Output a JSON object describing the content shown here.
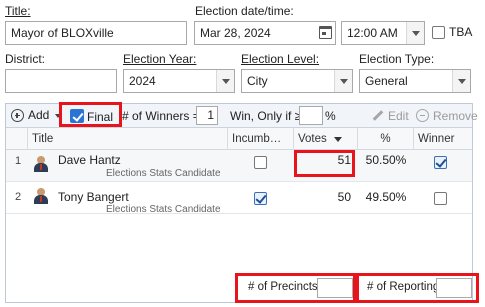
{
  "form": {
    "title_label": "Title:",
    "title_value": "Mayor of BLOXville",
    "date_label": "Election date/time:",
    "date_value": "Mar 28, 2024",
    "time_value": "12:00 AM",
    "tba_label": "TBA",
    "district_label": "District:",
    "district_value": "",
    "year_label": "Election Year:",
    "year_value": "2024",
    "level_label": "Election Level:",
    "level_value": "City",
    "type_label": "Election Type:",
    "type_value": "General"
  },
  "toolbar": {
    "add_label": "Add",
    "final_label": "Final",
    "winners_label": "# of Winners =",
    "winners_value": "1",
    "win_only_label": "Win, Only if ≥",
    "win_only_value": "",
    "percent_sign": "%",
    "edit_label": "Edit",
    "remove_label": "Remove"
  },
  "columns": {
    "title": "Title",
    "incumbent": "Incumb…",
    "votes": "Votes",
    "percent": "%",
    "winner": "Winner"
  },
  "rows": [
    {
      "num": "1",
      "name": "Dave Hantz",
      "subtitle": "Elections Stats Candidate",
      "incumbent": false,
      "votes": "51",
      "percent": "50.50%",
      "winner": true
    },
    {
      "num": "2",
      "name": "Tony Bangert",
      "subtitle": "Elections Stats Candidate",
      "incumbent": true,
      "votes": "50",
      "percent": "49.50%",
      "winner": false
    }
  ],
  "footer": {
    "precincts_label": "# of Precincts",
    "precincts_value": "",
    "reporting_label": "# of Reporting",
    "reporting_value": ""
  },
  "colors": {
    "highlight": "#e8141b",
    "accent": "#2b74d6"
  }
}
